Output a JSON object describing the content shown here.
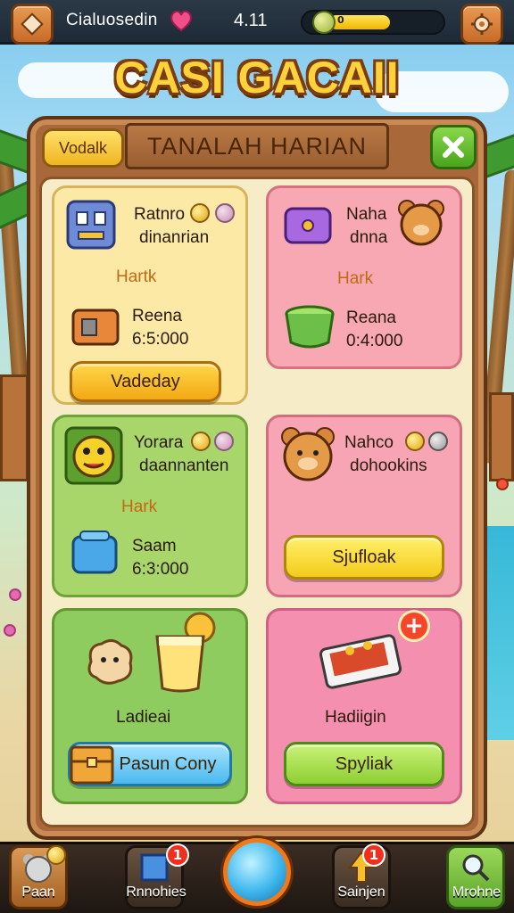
{
  "topbar": {
    "player_name": "Cialuosedin",
    "level": "4.11",
    "currency_value": "0",
    "currency_fill": 0.55
  },
  "title": "CASI GACAII",
  "panel": {
    "tab_label": "Vodalk",
    "header": "TANALAH HARIAN"
  },
  "cards": [
    {
      "line1": "Ratnro",
      "line2": "dinanrian",
      "mid": "Hartk",
      "name": "Reena",
      "value": "6:5:000",
      "button": "Vadeday"
    },
    {
      "line1": "Naha",
      "line2": "dnna",
      "mid": "Hark",
      "name": "Reana",
      "value": "0:4:000"
    },
    {
      "line1": "Yorara",
      "line2": "daannanten",
      "mid": "Hark",
      "name": "Saam",
      "value": "6:3:000"
    },
    {
      "line1": "Nahco",
      "line2": "dohookins",
      "button": "Sjufloak"
    },
    {
      "name": "Ladieai",
      "button": "Pasun Cony"
    },
    {
      "name": "Hadiigin",
      "button": "Spyliak"
    }
  ],
  "bottom_nav": [
    {
      "label": "Paan",
      "badge": ""
    },
    {
      "label": "Rnnohies",
      "badge": "1"
    },
    {
      "label": "Sainjen",
      "badge": "1"
    },
    {
      "label": "Mrohne",
      "badge": ""
    }
  ],
  "colors": {
    "accent_gold": "#ffd23a",
    "wood": "#a9683a",
    "notification_red": "#f0301f"
  }
}
